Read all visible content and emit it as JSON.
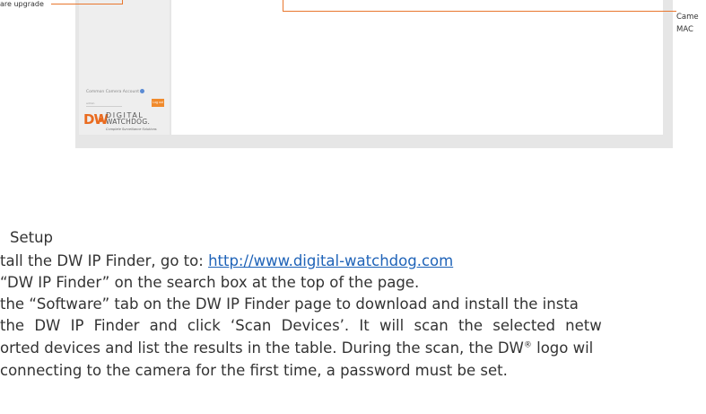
{
  "figure": {
    "callout_left": "are upgrade",
    "callout_right_line1": "Came",
    "callout_right_line2": "MAC",
    "sidebar": {
      "account_label": "Common Camera Account",
      "account_input_value": "admin",
      "logout_label": "Log out"
    },
    "logo": {
      "mark": "DW",
      "name_top": "DIGITAL",
      "name_bottom": "WATCHDOG.",
      "tagline": "Complete Surveillance Solutions"
    }
  },
  "section": {
    "title": "Setup",
    "lines": {
      "line1_prefix": "tall the DW IP Finder, go to: ",
      "line1_link": "http://www.digital-watchdog.com",
      "line2": " “DW IP Finder” on the search box at the top of the page.",
      "line3": " the “Software” tab on the DW IP Finder page to download and install the insta",
      "line4": " the DW IP Finder and click ‘Scan Devices’. It will scan the selected netw",
      "line5_prefix": "orted devices and list the results in the table. During the scan, the DW",
      "line5_sup": "®",
      "line5_suffix": " logo wil",
      "line6": " connecting to the camera for the first time, a password must be set."
    }
  },
  "colors": {
    "accent": "#e8772e",
    "link": "#1f63b8",
    "logo": "#ea6b1f"
  }
}
